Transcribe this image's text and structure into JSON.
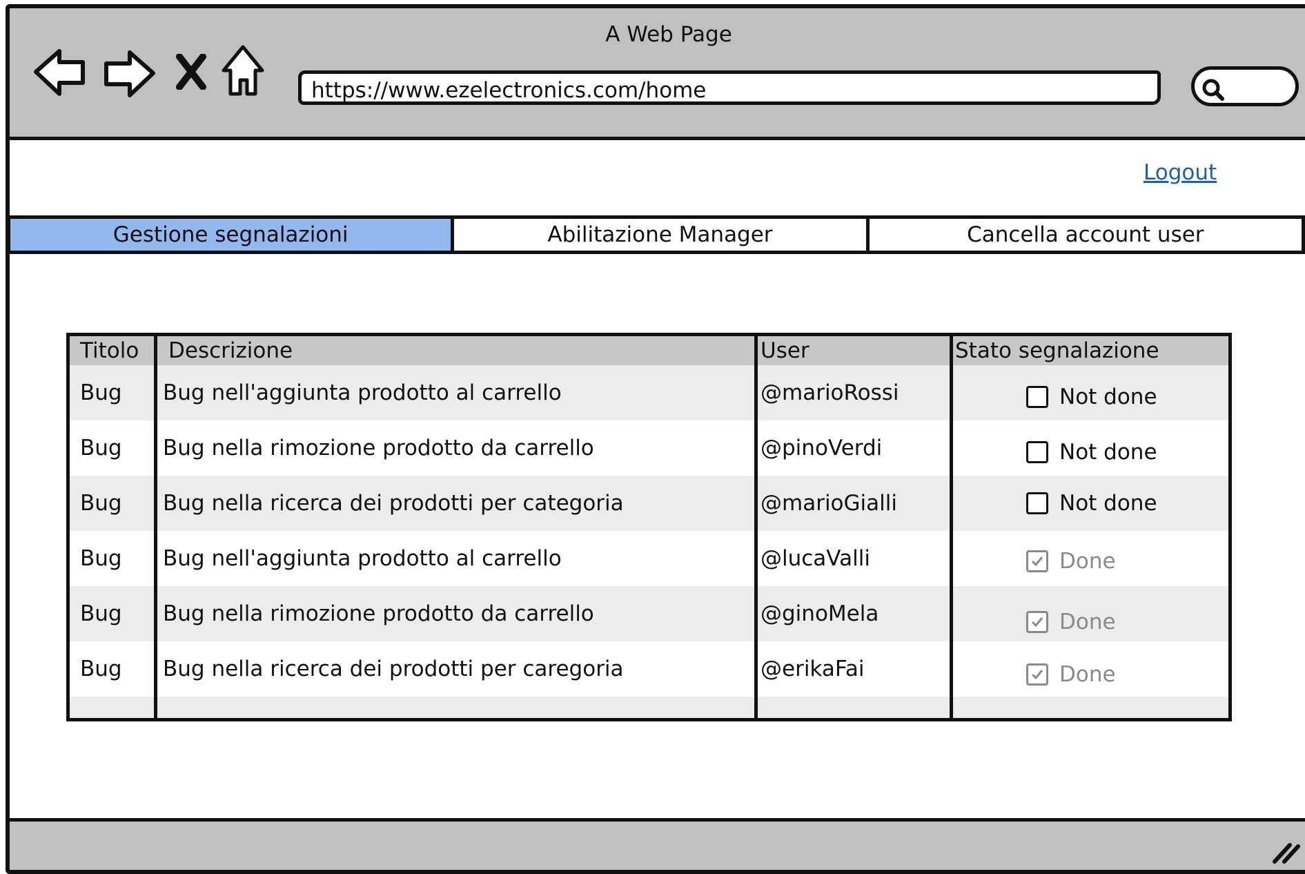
{
  "browser": {
    "window_title": "A Web Page",
    "url": "https://www.ezelectronics.com/home",
    "icons": [
      "back-arrow-icon",
      "forward-arrow-icon",
      "close-x-icon",
      "home-icon",
      "search-icon"
    ]
  },
  "header": {
    "logout_label": "Logout"
  },
  "tabs": [
    {
      "label": "Gestione segnalazioni",
      "active": true
    },
    {
      "label": "Abilitazione Manager",
      "active": false
    },
    {
      "label": "Cancella account user",
      "active": false
    }
  ],
  "table": {
    "headers": [
      "Titolo",
      "Descrizione",
      "User",
      "Stato segnalazione"
    ],
    "rows": [
      {
        "titolo": "Bug",
        "descrizione": "Bug nell'aggiunta prodotto al carrello",
        "user": "@marioRossi",
        "status": "Not done",
        "checked": false
      },
      {
        "titolo": "Bug",
        "descrizione": "Bug nella rimozione prodotto da carrello",
        "user": "@pinoVerdi",
        "status": "Not done",
        "checked": false
      },
      {
        "titolo": "Bug",
        "descrizione": "Bug nella ricerca dei prodotti per categoria",
        "user": "@marioGialli",
        "status": "Not done",
        "checked": false
      },
      {
        "titolo": "Bug",
        "descrizione": "Bug nell'aggiunta prodotto al carrello",
        "user": "@lucaValli",
        "status": "Done",
        "checked": true
      },
      {
        "titolo": "Bug",
        "descrizione": "Bug nella rimozione prodotto da carrello",
        "user": "@ginoMela",
        "status": "Done",
        "checked": true
      },
      {
        "titolo": "Bug",
        "descrizione": "Bug nella ricerca dei prodotti per caregoria",
        "user": "@erikaFai",
        "status": "Done",
        "checked": true
      }
    ]
  },
  "colors": {
    "active_tab": "#93b8ee",
    "chrome_gray": "#c0c0c0",
    "link_blue": "#1f5fa8",
    "done_gray": "#8a8a8a"
  }
}
